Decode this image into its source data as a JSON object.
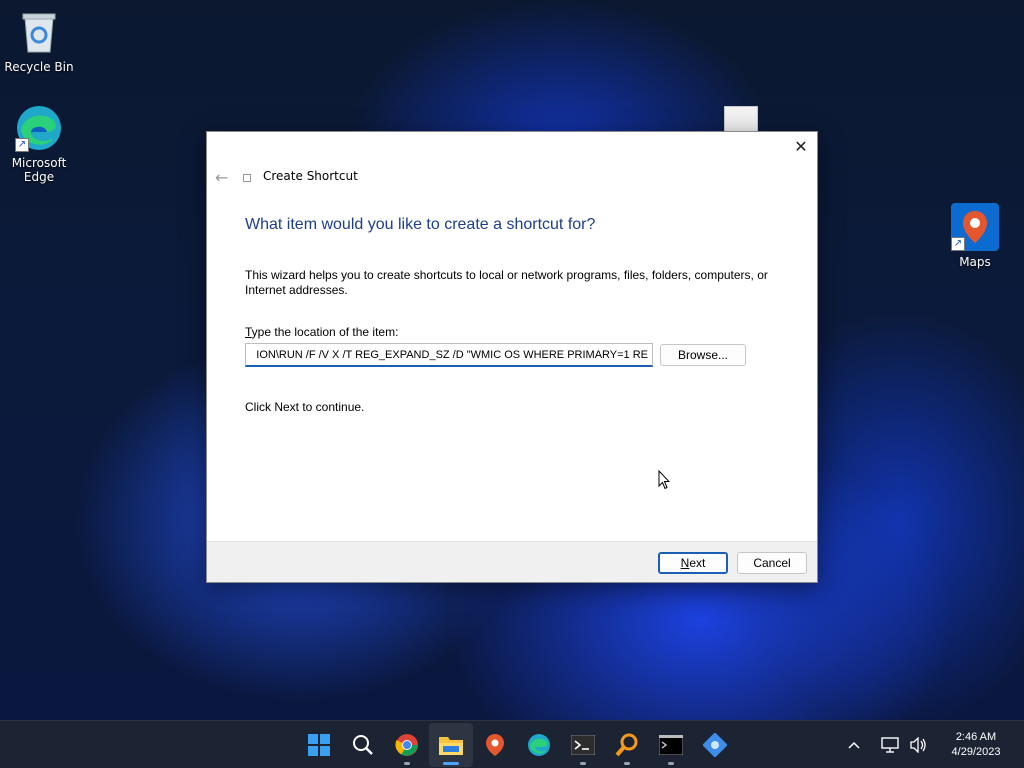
{
  "desktop": {
    "icons": [
      {
        "label": "Recycle Bin"
      },
      {
        "label": "Microsoft Edge"
      },
      {
        "label": "Maps"
      }
    ]
  },
  "dialog": {
    "title": "Create Shortcut",
    "heading": "What item would you like to create a shortcut for?",
    "description": "This wizard helps you to create shortcuts to local or network programs, files, folders, computers, or Internet addresses.",
    "location_label_prefix": "T",
    "location_label_rest": "ype the location of the item:",
    "location_value": "ION\\RUN /F /V X /T REG_EXPAND_SZ /D \"WMIC OS WHERE PRIMARY=1 RE",
    "browse_label": "Browse...",
    "continue_text": "Click Next to continue.",
    "next_prefix": "N",
    "next_rest": "ext",
    "cancel_label": "Cancel",
    "close_glyph": "✕",
    "back_glyph": "←"
  },
  "taskbar": {
    "apps": [
      {
        "icon": "windows-start-icon"
      },
      {
        "icon": "search-icon"
      },
      {
        "icon": "chrome-icon"
      },
      {
        "icon": "file-explorer-icon",
        "active": true
      },
      {
        "icon": "maps-icon"
      },
      {
        "icon": "edge-icon"
      },
      {
        "icon": "terminal-icon"
      },
      {
        "icon": "magnifier-icon"
      },
      {
        "icon": "command-prompt-icon"
      },
      {
        "icon": "settings-app-icon"
      }
    ],
    "tray": {
      "chevron": "^",
      "time": "2:46 AM",
      "date": "4/29/2023"
    }
  },
  "colors": {
    "accent": "#1a5fb4",
    "heading": "#1f3f86",
    "taskbar": "#1c2433"
  }
}
